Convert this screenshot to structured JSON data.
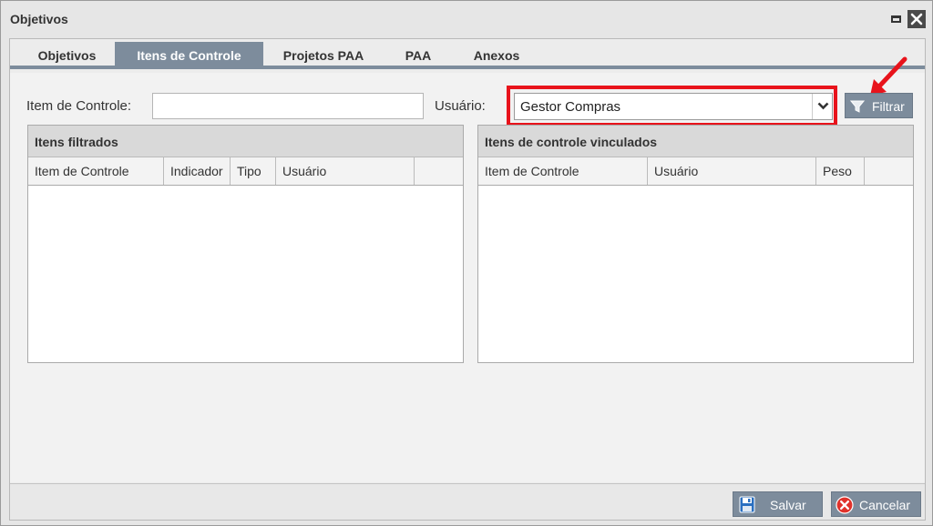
{
  "window": {
    "title": "Objetivos"
  },
  "tabs": [
    {
      "label": "Objetivos",
      "active": false
    },
    {
      "label": "Itens de Controle",
      "active": true
    },
    {
      "label": "Projetos PAA",
      "active": false
    },
    {
      "label": "PAA",
      "active": false
    },
    {
      "label": "Anexos",
      "active": false
    }
  ],
  "filter": {
    "item_label": "Item de Controle:",
    "item_value": "",
    "user_label": "Usuário:",
    "user_selected": "Gestor Compras",
    "filter_button": "Filtrar"
  },
  "left_grid": {
    "title": "Itens filtrados",
    "columns": [
      "Item de Controle",
      "Indicador",
      "Tipo",
      "Usuário",
      ""
    ]
  },
  "right_grid": {
    "title": "Itens de controle vinculados",
    "columns": [
      "Item de Controle",
      "Usuário",
      "Peso",
      ""
    ]
  },
  "footer": {
    "save_label": "Salvar",
    "cancel_label": "Cancelar"
  },
  "colors": {
    "accent": "#7d8c9c",
    "highlight": "#e8131b",
    "cancel_icon": "#e0322b",
    "save_icon": "#2a6fc0"
  },
  "icons": [
    "maximize-icon",
    "close-icon",
    "chevron-down-icon",
    "funnel-icon",
    "floppy-disk-icon",
    "cancel-x-icon"
  ]
}
